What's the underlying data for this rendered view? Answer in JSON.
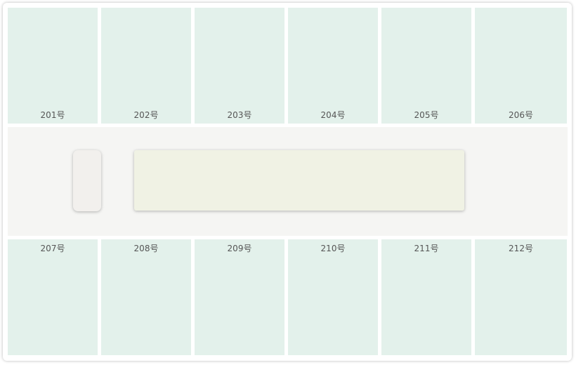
{
  "colors": {
    "room_fill": "#e3f1eb",
    "corridor_fill": "#f5f5f3",
    "table_fill": "#f0f2e4",
    "pillar_fill": "#f2f0ed",
    "label_text": "#555555"
  },
  "rooms_top": [
    "201号",
    "202号",
    "203号",
    "204号",
    "205号",
    "206号"
  ],
  "rooms_bottom": [
    "207号",
    "208号",
    "209号",
    "210号",
    "211号",
    "212号"
  ]
}
